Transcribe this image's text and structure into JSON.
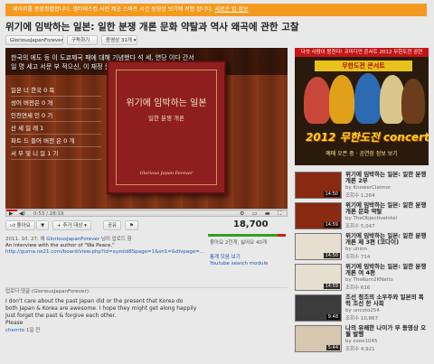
{
  "banner": {
    "text": "페이지를 중앙정렬합니다. 멀티태스킹 사전 제공 스마트 시간 동영상 보기에 적합 합니다.",
    "link": "새로운 업 정보"
  },
  "video": {
    "title": "위기에 임박하는 일본: 일한 분쟁 개론 문화 약탈과 역사 왜곡에 관한 고찰",
    "channel": "GloriousJapanForever",
    "subscribe": "구독하기",
    "videos_count": "동영상 31개",
    "subtitle_1": "한국의 에도 등 이 도쿄제국 패에 대해 기념했다 석 세, 연당 이다 간서",
    "subtitle_2": "일 명 세고 서문 부 적으신, 이 재정 문제는 로서 돼 이 당합니다.",
    "book_title": "위기에 임박하는 일본",
    "book_subtitle": "일한 분쟁 개론",
    "book_author": "Glorious Japan Forever",
    "chapters": [
      "일본 너 한국 0 목",
      "성어 버전은 0 개",
      "인천연세 인 0 기",
      "산 세 일 레 1",
      "파트 드 들어 버전 은 0 개",
      "서 부 및 니 일 1 기"
    ],
    "progress_pct": 4,
    "time": "0:53 / 28:19",
    "like_label": "좋아요",
    "add_label": "+ 추가 대상",
    "share_label": "공유",
    "views": "18,700",
    "likes_text": "좋아요 2천개, 싫어요 40개",
    "like_ratio": 0.9,
    "upload_line_date": "2011. 10. 27. 에",
    "upload_line_channel": "GloriousJapanForever",
    "upload_line_suffix": "님이 업로드 함",
    "desc_line": "An interview with the author of \"Wa Peace.\"",
    "desc_url": "http://gurna.ne21.com/board/view.php?id=xyzold8Spage=1&sn1=&divpage=...",
    "stats_label": "통계 모음 보기",
    "search_module": "Youtube search module",
    "comment_label": "업로더 댓글 (GloriousJapanForever):",
    "comment_lines": [
      "I don't care about the past Japan did or the present that Korea do",
      "both Japan & Korea are awesome. I hope they might get along happily",
      "Just forget the past & forgive each other.",
      "Please"
    ],
    "comment_author": "chernto",
    "comment_time": "1일 전"
  },
  "ad": {
    "top": "다섯 사람이 뭉친다! 코미디언 콘서트 2012 무한도전 공연",
    "headline": "무한도전 콘서트",
    "big": "2012 무한도전 concert",
    "sub": "예매 오픈 중 · 공연장 정보 보기"
  },
  "related": [
    {
      "title": "위기에 임박하는 일본: 일한 분쟁 개론 2부",
      "meta1": "by KnowerClaimor",
      "meta2": "조회수 1,264",
      "dur": "14:50"
    },
    {
      "title": "위기에 임박하는 일본: 일한 분쟁 개론 문화 약탈",
      "meta1": "by TheObjectiveIntel",
      "meta2": "조회수 5,047",
      "dur": "14:59"
    },
    {
      "title": "위기에 임박하는 일본: 일한 분쟁 개론 제 3편 (코다이)",
      "meta1": "by uhinn",
      "meta2": "조회수 714",
      "dur": "14:50"
    },
    {
      "title": "위기에 임박하는 일본: 일한 분쟁 개론 여 4편",
      "meta1": "by TheKorn2KNatio",
      "meta2": "조회수 616",
      "dur": "14:59"
    },
    {
      "title": "조선 청조의 소우주와 일본의 폭력 조선 한 사회",
      "meta1": "by uncoto254",
      "meta2": "조회수 10,867",
      "dur": "9:48"
    },
    {
      "title": "나의 유쾌한 나이가 부 동영상 오월 발행",
      "meta1": "by sooo1045",
      "meta2": "조회수 4,921",
      "dur": "5:44"
    }
  ]
}
